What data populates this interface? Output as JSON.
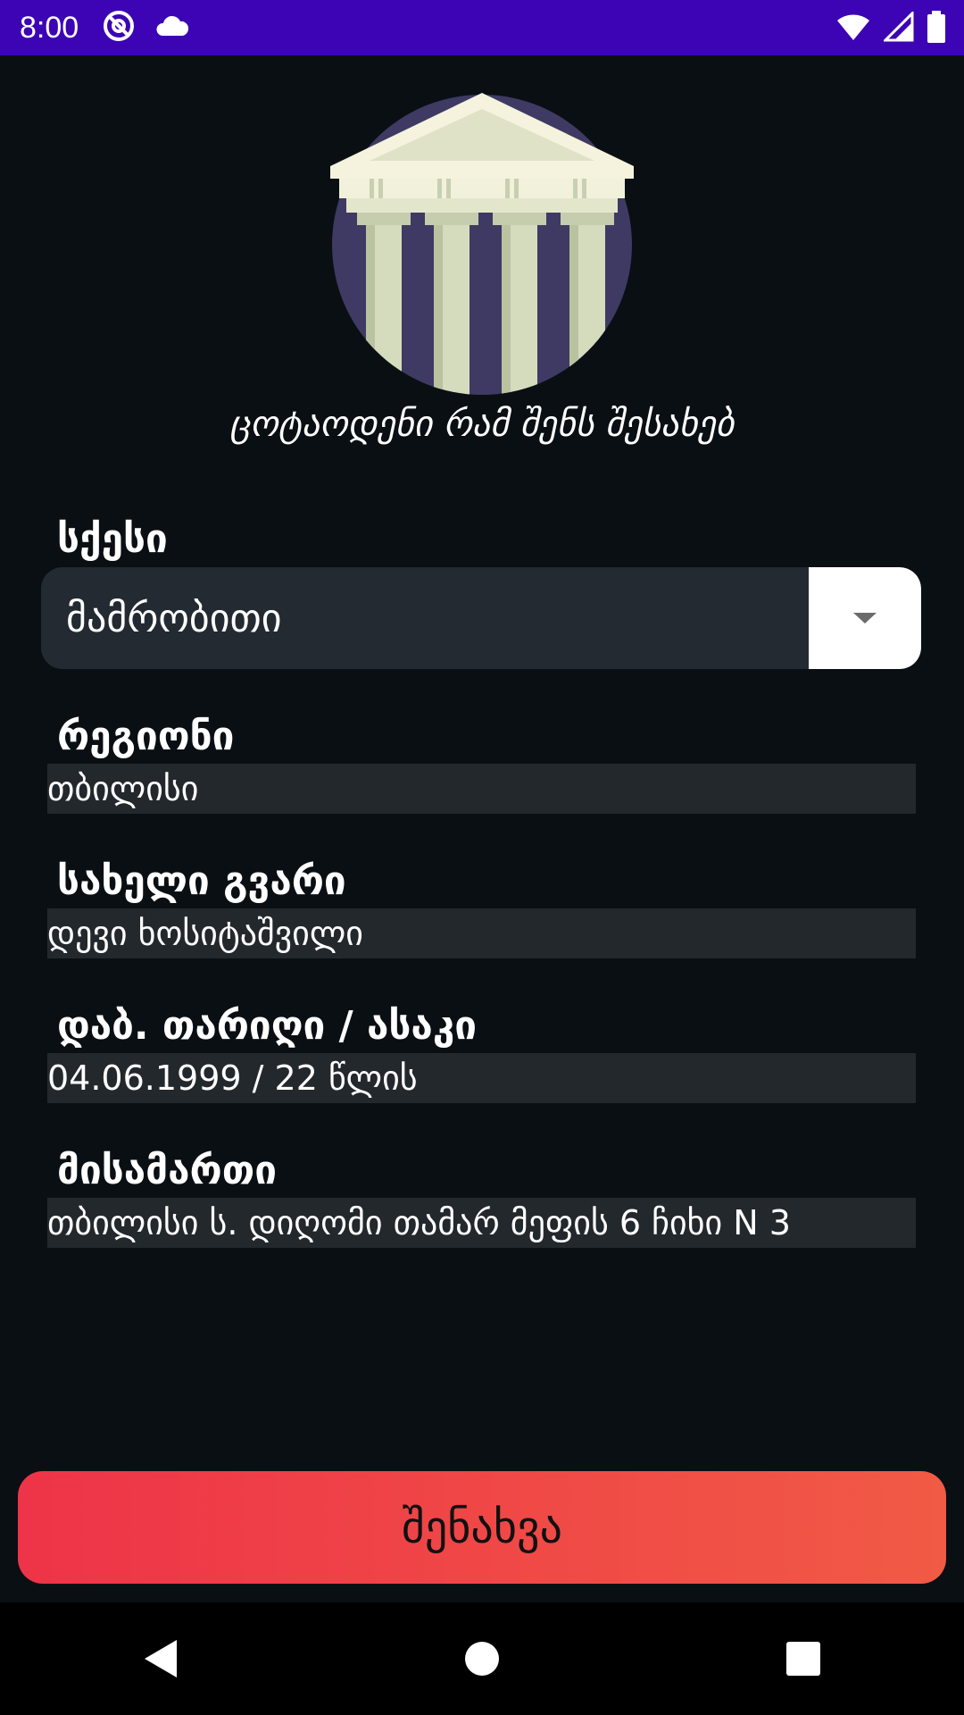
{
  "status_bar": {
    "time": "8:00",
    "icons": [
      "do-not-disturb-icon",
      "cloud-icon",
      "wifi-icon",
      "signal-icon",
      "battery-icon"
    ]
  },
  "header": {
    "subtitle": "ცოტაოდენი რამ შენს შესახებ"
  },
  "form": {
    "gender": {
      "label": "სქესი",
      "value": "მამრობითი"
    },
    "region": {
      "label": "რეგიონი",
      "value": "თბილისი"
    },
    "name": {
      "label": "სახელი გვარი",
      "value": "დევი ხოსიტაშვილი"
    },
    "birth": {
      "label": "დაბ. თარიღი / ასაკი",
      "value": "04.06.1999  /  22 წლის"
    },
    "address": {
      "label": "მისამართი",
      "value": "თბილისი ს. დიღომი თამარ მეფის 6 ჩიხი N 3"
    }
  },
  "actions": {
    "save_label": "შენახვა"
  },
  "colors": {
    "status_bar": "#3c04b4",
    "background": "#0a0f14",
    "button_gradient_start": "#ee3448",
    "button_gradient_end": "#f15a45"
  }
}
